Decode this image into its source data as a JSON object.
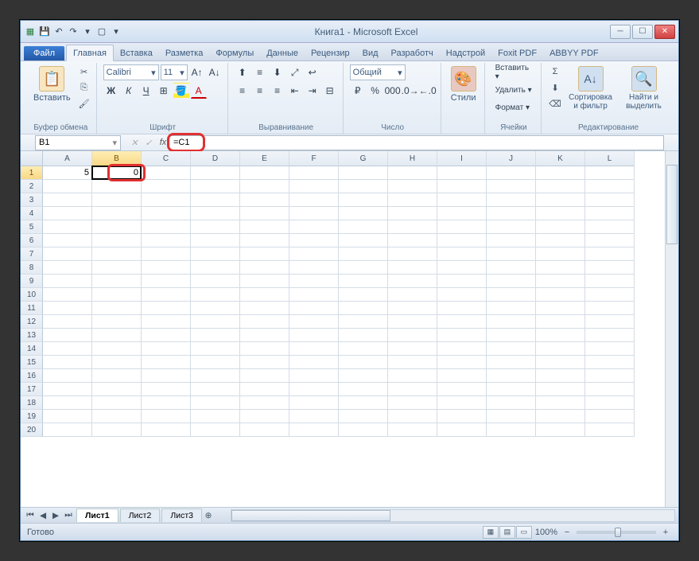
{
  "title": "Книга1  -  Microsoft Excel",
  "qat": {
    "save": "💾",
    "undo": "↶",
    "redo": "↷"
  },
  "file_tab": "Файл",
  "tabs": [
    "Главная",
    "Вставка",
    "Разметка",
    "Формулы",
    "Данные",
    "Рецензир",
    "Вид",
    "Разработч",
    "Надстрой",
    "Foxit PDF",
    "ABBYY PDF"
  ],
  "active_tab": 0,
  "ribbon": {
    "clipboard": {
      "paste": "Вставить",
      "label": "Буфер обмена"
    },
    "font": {
      "name": "Calibri",
      "size": "11",
      "label": "Шрифт"
    },
    "alignment": {
      "label": "Выравнивание"
    },
    "number": {
      "format": "Общий",
      "label": "Число"
    },
    "styles": {
      "btn": "Стили",
      "label": ""
    },
    "cells": {
      "insert": "Вставить ▾",
      "delete": "Удалить ▾",
      "format": "Формат ▾",
      "label": "Ячейки"
    },
    "editing": {
      "sort": "Сортировка и фильтр",
      "find": "Найти и выделить",
      "label": "Редактирование"
    }
  },
  "namebox": "B1",
  "formula": "=C1",
  "columns": [
    "A",
    "B",
    "C",
    "D",
    "E",
    "F",
    "G",
    "H",
    "I",
    "J",
    "K",
    "L"
  ],
  "rows": 20,
  "cells": {
    "A1": "5",
    "B1": "0"
  },
  "active_cell": "B1",
  "sheets": [
    "Лист1",
    "Лист2",
    "Лист3"
  ],
  "active_sheet": 0,
  "status": "Готово",
  "zoom": "100%"
}
